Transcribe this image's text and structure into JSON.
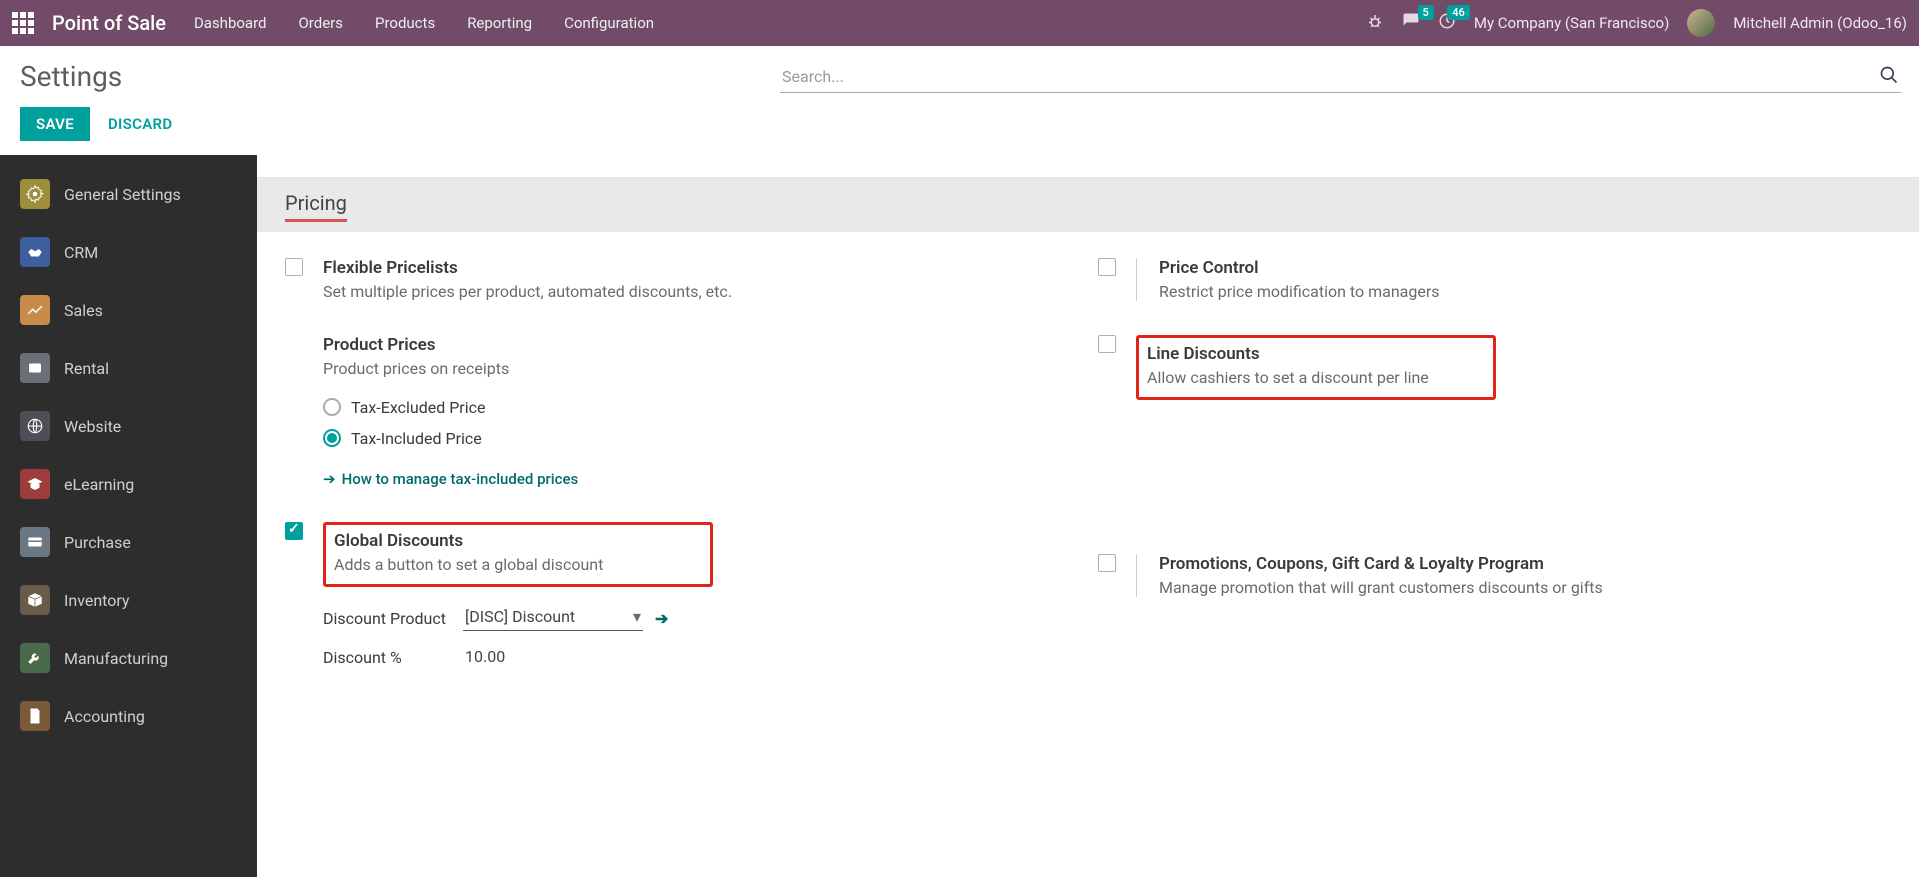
{
  "nav": {
    "brand": "Point of Sale",
    "links": [
      "Dashboard",
      "Orders",
      "Products",
      "Reporting",
      "Configuration"
    ],
    "chat_badge": "5",
    "clock_badge": "46",
    "company": "My Company (San Francisco)",
    "user": "Mitchell Admin (Odoo_16)"
  },
  "page": {
    "title": "Settings",
    "save": "SAVE",
    "discard": "DISCARD",
    "search_placeholder": "Search..."
  },
  "sidebar": {
    "items": [
      {
        "label": "General Settings",
        "color": "#9e8e3a"
      },
      {
        "label": "CRM",
        "color": "#3f5ea0"
      },
      {
        "label": "Sales",
        "color": "#c88b4a"
      },
      {
        "label": "Rental",
        "color": "#6d6f78"
      },
      {
        "label": "Website",
        "color": "#4e4e56"
      },
      {
        "label": "eLearning",
        "color": "#9e3c3c"
      },
      {
        "label": "Purchase",
        "color": "#6b7884"
      },
      {
        "label": "Inventory",
        "color": "#6a5a4a"
      },
      {
        "label": "Manufacturing",
        "color": "#4b6a4b"
      },
      {
        "label": "Accounting",
        "color": "#7a5a3a"
      }
    ]
  },
  "section": {
    "pricing": "Pricing"
  },
  "settings": {
    "flexible_pricelists": {
      "title": "Flexible Pricelists",
      "desc": "Set multiple prices per product, automated discounts, etc."
    },
    "product_prices": {
      "title": "Product Prices",
      "desc": "Product prices on receipts"
    },
    "tax_excluded": "Tax-Excluded Price",
    "tax_included": "Tax-Included Price",
    "tax_help": "How to manage tax-included prices",
    "global_discounts": {
      "title": "Global Discounts",
      "desc": "Adds a button to set a global discount"
    },
    "discount_product_label": "Discount Product",
    "discount_product_value": "[DISC] Discount",
    "discount_pc_label": "Discount %",
    "discount_pc_value": "10.00",
    "price_control": {
      "title": "Price Control",
      "desc": "Restrict price modification to managers"
    },
    "line_discounts": {
      "title": "Line Discounts",
      "desc": "Allow cashiers to set a discount per line"
    },
    "promotions": {
      "title": "Promotions, Coupons, Gift Card & Loyalty Program",
      "desc": "Manage promotion that will grant customers discounts or gifts"
    }
  }
}
